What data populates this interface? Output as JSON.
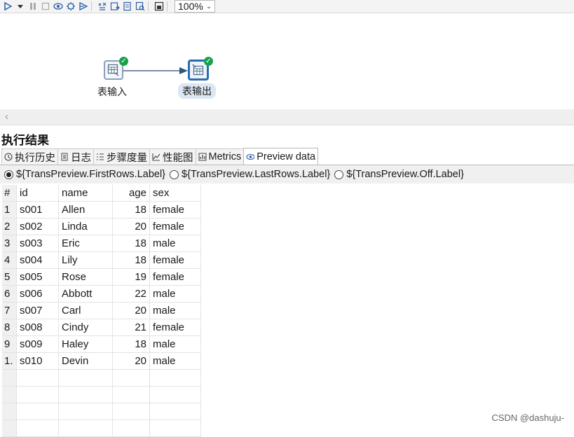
{
  "toolbar": {
    "icons": [
      "run-icon",
      "run-dropdown-icon",
      "pause-icon",
      "stop-icon",
      "preview-icon",
      "debug-icon",
      "replay-icon",
      "verify-icon",
      "impact-icon",
      "sql-icon",
      "explore-db-icon",
      "show-results-icon"
    ],
    "zoom": "100%"
  },
  "canvas": {
    "steps": [
      {
        "label": "表输入",
        "status": "success"
      },
      {
        "label": "表输出",
        "status": "success"
      }
    ]
  },
  "results": {
    "title": "执行结果",
    "tabs": [
      {
        "label": "执行历史",
        "icon": "history-icon"
      },
      {
        "label": "日志",
        "icon": "log-icon"
      },
      {
        "label": "步骤度量",
        "icon": "step-metrics-icon"
      },
      {
        "label": "性能图",
        "icon": "performance-chart-icon"
      },
      {
        "label": "Metrics",
        "icon": "metrics-icon"
      },
      {
        "label": "Preview data",
        "icon": "eye-icon",
        "active": true
      }
    ],
    "radios": [
      {
        "label": "${TransPreview.FirstRows.Label}",
        "checked": true
      },
      {
        "label": "${TransPreview.LastRows.Label}",
        "checked": false
      },
      {
        "label": "${TransPreview.Off.Label}",
        "checked": false
      }
    ],
    "table": {
      "headers": [
        "#",
        "id",
        "name",
        "age",
        "sex"
      ],
      "rows": [
        [
          "1",
          "s001",
          "Allen",
          "18",
          "female"
        ],
        [
          "2",
          "s002",
          "Linda",
          "20",
          "female"
        ],
        [
          "3",
          "s003",
          "Eric",
          "18",
          "male"
        ],
        [
          "4",
          "s004",
          "Lily",
          "18",
          "female"
        ],
        [
          "5",
          "s005",
          "Rose",
          "19",
          "female"
        ],
        [
          "6",
          "s006",
          "Abbott",
          "22",
          "male"
        ],
        [
          "7",
          "s007",
          "Carl",
          "20",
          "male"
        ],
        [
          "8",
          "s008",
          "Cindy",
          "21",
          "female"
        ],
        [
          "9",
          "s009",
          "Haley",
          "18",
          "male"
        ],
        [
          "1.",
          "s010",
          "Devin",
          "20",
          "male"
        ]
      ]
    }
  },
  "watermark": "CSDN @dashuju-"
}
